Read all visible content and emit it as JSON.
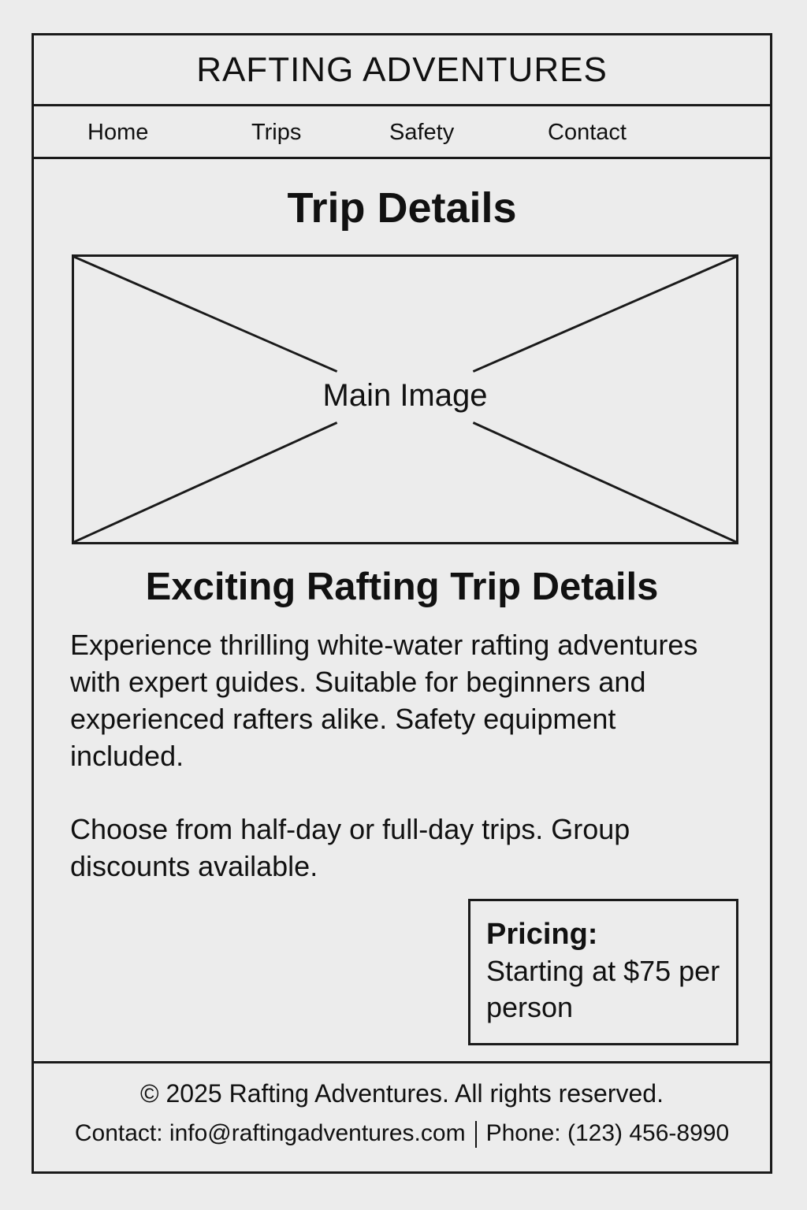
{
  "header": {
    "site_title": "RAFTING ADVENTURES"
  },
  "nav": {
    "items": [
      {
        "label": "Home"
      },
      {
        "label": "Trips"
      },
      {
        "label": "Safety"
      },
      {
        "label": "Contact"
      }
    ]
  },
  "main": {
    "page_title": "Trip Details",
    "image_placeholder": "Main Image",
    "section_title": "Exciting Rafting Trip Details",
    "description": "Experience thrilling white-water rafting adventures with expert guides. Suitable for beginners and experienced rafters alike. Safety equipment included.",
    "description_2": "Choose from half-day or full-day trips. Group discounts available.",
    "pricing": {
      "label": "Pricing:",
      "text": "Starting at $75 per person"
    }
  },
  "footer": {
    "copyright": "© 2025 Rafting Adventures. All rights reserved.",
    "contact": "Contact: info@raftingadventures.com",
    "phone": "Phone: (123) 456-8990"
  },
  "colors": {
    "background": "#ececec",
    "line": "#1a1a1a"
  }
}
